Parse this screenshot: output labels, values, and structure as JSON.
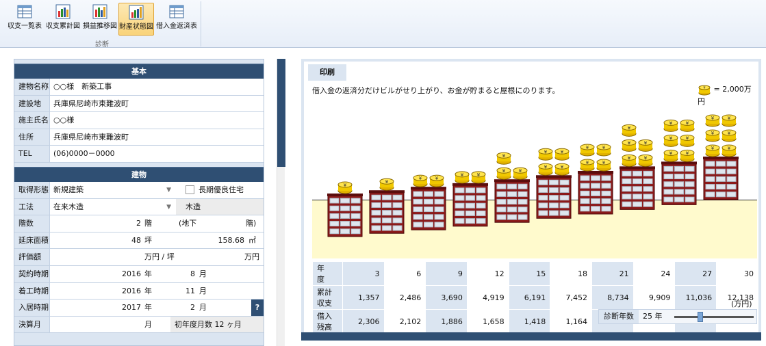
{
  "ribbon": {
    "buttons": [
      {
        "label": "収支一覧表",
        "icon": "table-icon"
      },
      {
        "label": "収支累計図",
        "icon": "bar-chart-icon"
      },
      {
        "label": "損益推移図",
        "icon": "bar-chart-icon"
      },
      {
        "label": "財産状態図",
        "icon": "bar-chart-icon",
        "active": true
      },
      {
        "label": "借入金返済表",
        "icon": "table-icon"
      }
    ],
    "group_label": "診断"
  },
  "basic": {
    "title": "基本",
    "rows": [
      {
        "label": "建物名称",
        "value": "○○様　新築工事"
      },
      {
        "label": "建設地",
        "value": "兵庫県尼崎市東難波町"
      },
      {
        "label": "施主氏名",
        "value": "○○様"
      },
      {
        "label": "住所",
        "value": "兵庫県尼崎市東難波町"
      },
      {
        "label": "TEL",
        "value": "(06)0000－0000"
      }
    ]
  },
  "building": {
    "title": "建物",
    "acquisition": {
      "label": "取得形態",
      "value": "新規建築",
      "checkbox_label": "長期優良住宅"
    },
    "method": {
      "label": "工法",
      "value": "在来木造",
      "type": "木造"
    },
    "floors": {
      "label": "階数",
      "value": "2",
      "unit": "階",
      "basement_open": "(地下",
      "basement_close": "階)"
    },
    "area": {
      "label": "延床面積",
      "tsubo": "48",
      "tsubo_unit": "坪",
      "sqm": "158.68",
      "sqm_unit": "㎡"
    },
    "valuation": {
      "label": "評価額",
      "unit1": "万円 / 坪",
      "unit2": "万円"
    },
    "contract": {
      "label": "契約時期",
      "year": "2016",
      "year_unit": "年",
      "month": "8",
      "month_unit": "月"
    },
    "start": {
      "label": "着工時期",
      "year": "2016",
      "year_unit": "年",
      "month": "11",
      "month_unit": "月"
    },
    "movein": {
      "label": "入居時期",
      "year": "2017",
      "year_unit": "年",
      "month": "2",
      "month_unit": "月",
      "help": "?"
    },
    "settlement": {
      "label": "決算月",
      "month_unit": "月",
      "first_year": "初年度月数 12 ヶ月"
    }
  },
  "chart": {
    "tab_label": "印刷",
    "caption": "借入金の返済分だけビルがせり上がり、お金が貯まると屋根にのります。",
    "legend_text": "= 2,000万円",
    "table_headers": {
      "year": "年　度",
      "cumulative": "累計収支",
      "loan": "借入残高"
    },
    "unit": "(万円)",
    "years_label": "診断年数",
    "years_value": "25 年"
  },
  "chart_data": {
    "type": "table",
    "categories": [
      "3",
      "6",
      "9",
      "12",
      "15",
      "18",
      "21",
      "24",
      "27",
      "30"
    ],
    "series": [
      {
        "name": "累計収支",
        "values": [
          1357,
          2486,
          3690,
          4919,
          6191,
          7452,
          8734,
          9909,
          11036,
          12138
        ]
      },
      {
        "name": "借入残高",
        "values": [
          2306,
          2102,
          1886,
          1658,
          1418,
          1164,
          896,
          613,
          315,
          null
        ]
      }
    ],
    "coins_per_building": [
      1,
      1,
      2,
      2,
      3,
      4,
      4,
      5,
      6,
      6
    ],
    "coin_value": 2000,
    "slider_value": 25
  }
}
